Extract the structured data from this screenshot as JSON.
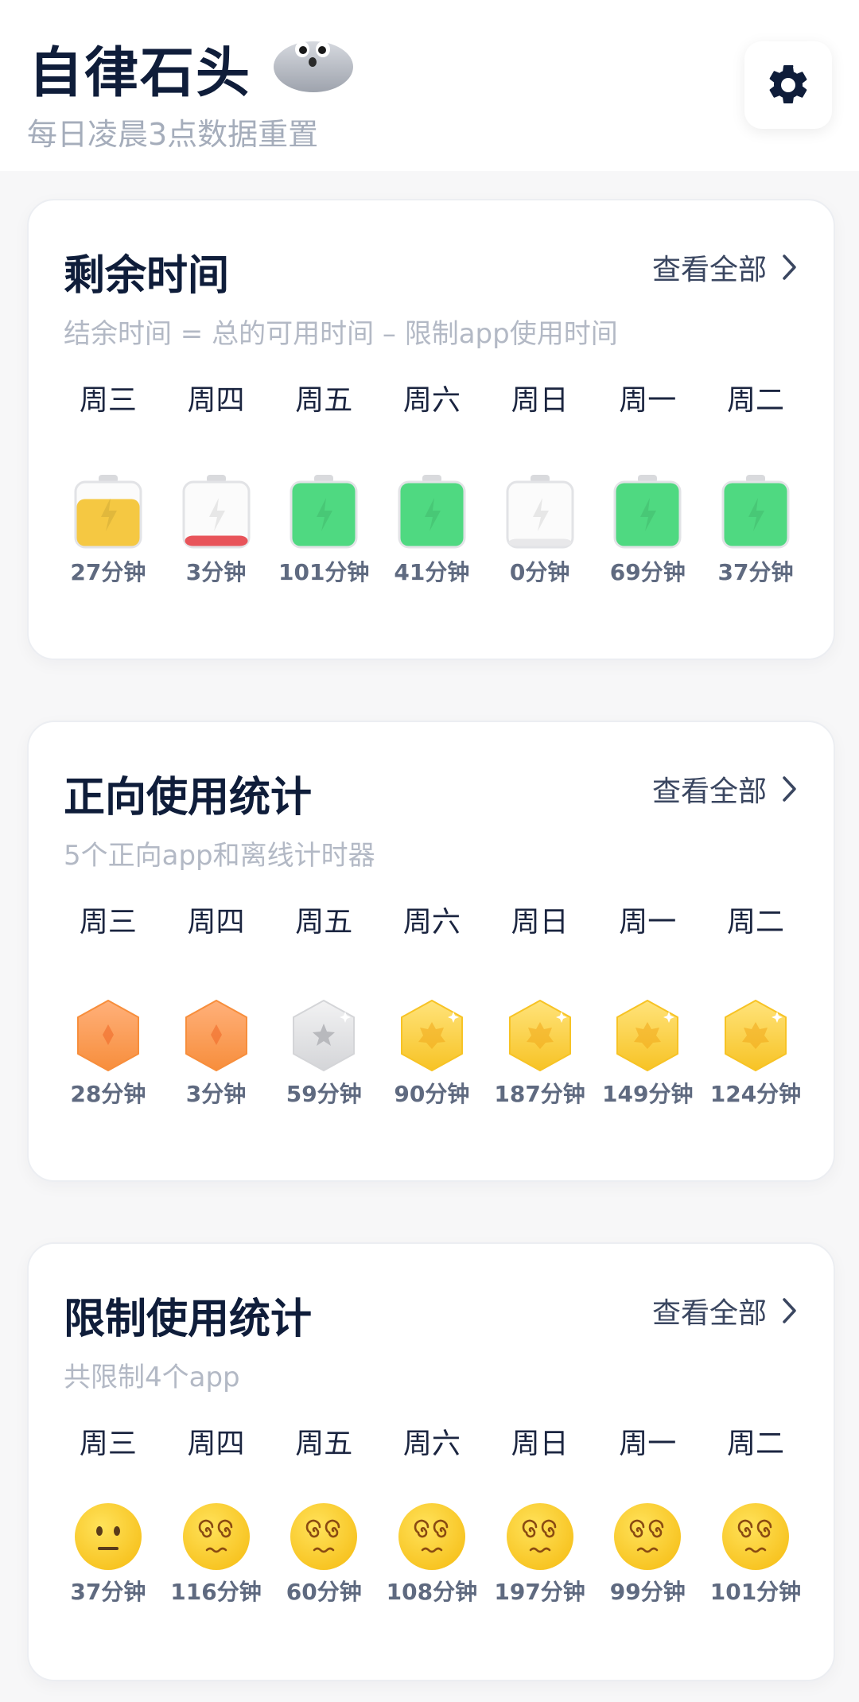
{
  "header": {
    "title": "自律石头",
    "subtitle": "每日凌晨3点数据重置",
    "mascot_icon": "stone-mascot-icon",
    "settings_icon": "gear-icon"
  },
  "days": [
    "周三",
    "周四",
    "周五",
    "周六",
    "周日",
    "周一",
    "周二"
  ],
  "cards": {
    "remaining": {
      "title": "剩余时间",
      "link": "查看全部",
      "desc": "结余时间 = 总的可用时间 – 限制app使用时间",
      "values": [
        "27分钟",
        "3分钟",
        "101分钟",
        "41分钟",
        "0分钟",
        "69分钟",
        "37分钟"
      ],
      "battery_levels": [
        0.75,
        0.2,
        1.0,
        1.0,
        0.15,
        1.0,
        1.0
      ],
      "battery_colors": [
        "#f5c842",
        "#e8545a",
        "#4fd981",
        "#4fd981",
        "#e8e8ea",
        "#4fd981",
        "#4fd981"
      ]
    },
    "positive": {
      "title": "正向使用统计",
      "link": "查看全部",
      "desc": "5个正向app和离线计时器",
      "values": [
        "28分钟",
        "3分钟",
        "59分钟",
        "90分钟",
        "187分钟",
        "149分钟",
        "124分钟"
      ],
      "medal_types": [
        "bronze",
        "bronze",
        "silver",
        "gold",
        "gold",
        "gold",
        "gold"
      ]
    },
    "limited": {
      "title": "限制使用统计",
      "link": "查看全部",
      "desc": "共限制4个app",
      "values": [
        "37分钟",
        "116分钟",
        "60分钟",
        "108分钟",
        "197分钟",
        "99分钟",
        "101分钟"
      ],
      "emoji_types": [
        "neutral",
        "dizzy",
        "dizzy",
        "dizzy",
        "dizzy",
        "dizzy",
        "dizzy"
      ]
    }
  },
  "colors": {
    "title": "#0f1d3a",
    "muted": "#b3b9c5",
    "green": "#4fd981",
    "gold": "#f7c325",
    "bronze": "#f78e3c"
  }
}
